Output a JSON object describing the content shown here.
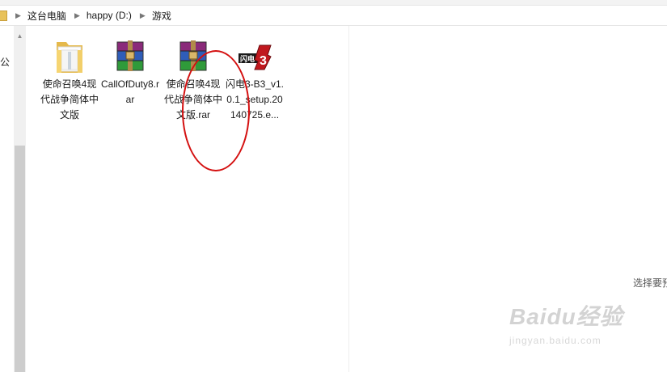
{
  "address": {
    "crumbs": [
      "这台电脑",
      "happy (D:)",
      "游戏"
    ]
  },
  "nav": {
    "partial_label": "公"
  },
  "files": [
    {
      "name": "使命召唤4现代战争简体中文版",
      "type": "folder",
      "icon": "folder-icon"
    },
    {
      "name": "CallOfDuty8.rar",
      "type": "rar",
      "icon": "winrar-archive-icon"
    },
    {
      "name": "使命召唤4现代战争简体中文版.rar",
      "type": "rar",
      "icon": "winrar-archive-icon",
      "highlighted": true
    },
    {
      "name": "闪电3-B3_v1.0.1_setup.20140725.e...",
      "type": "exe",
      "icon": "game-3-exe-icon"
    }
  ],
  "preview": {
    "text": "选择要预"
  },
  "watermark": {
    "logo": "Baidu经验",
    "url": "jingyan.baidu.com"
  },
  "colors": {
    "highlight": "#d41010",
    "folder": "#f2cf6a"
  }
}
